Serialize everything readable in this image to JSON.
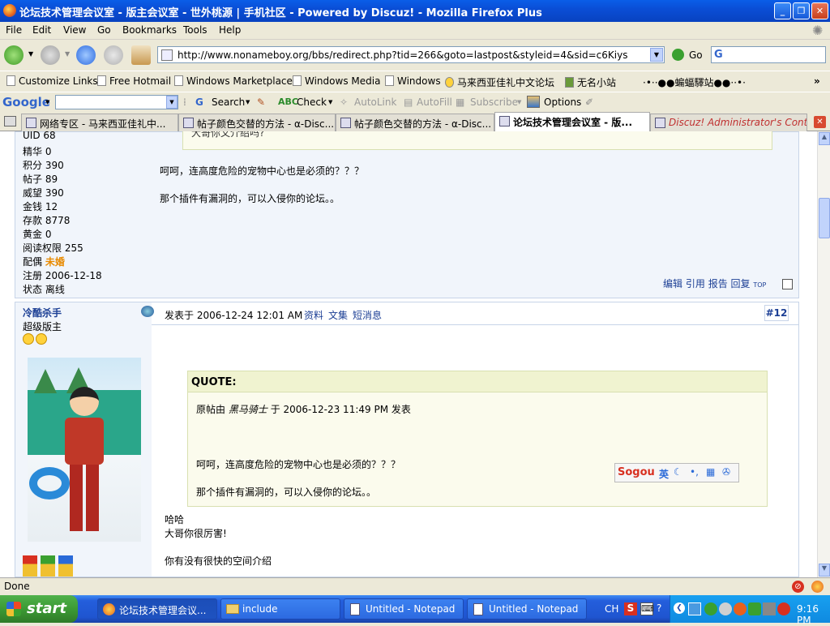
{
  "window": {
    "title": "论坛技术管理会议室 - 版主会议室 - 世外桃源 | 手机社区 - Powered by Discuz! - Mozilla Firefox Plus"
  },
  "menu": [
    "File",
    "Edit",
    "View",
    "Go",
    "Bookmarks",
    "Tools",
    "Help"
  ],
  "nav": {
    "url": "http://www.nonameboy.org/bbs/redirect.php?tid=266&goto=lastpost&styleid=4&sid=c6Kiys",
    "go_label": "Go"
  },
  "bookmarks": [
    "Customize Links",
    "Free Hotmail",
    "Windows Marketplace",
    "Windows Media",
    "Windows",
    "马来西亚佳礼中文论坛",
    "无名小站",
    "·•··●●蝙蝠驛站●●··•·"
  ],
  "googlebar": {
    "logo": "Google",
    "search": "Search",
    "check": "Check",
    "autolink": "AutoLink",
    "autofill": "AutoFill",
    "subscribe": "Subscribe",
    "options": "Options"
  },
  "tabs": [
    {
      "label": "网络专区 - 马来西亚佳礼中..."
    },
    {
      "label": "帖子颜色交替的方法 - α-Disc..."
    },
    {
      "label": "帖子颜色交替的方法 - α-Disc..."
    },
    {
      "label": "论坛技术管理会议室 - 版..."
    },
    {
      "label": "Discuz! Administrator's Cont..."
    }
  ],
  "post1": {
    "stats": [
      {
        "label": "UID",
        "value": "68"
      },
      {
        "label": "精华",
        "value": "0"
      },
      {
        "label": "积分",
        "value": "390"
      },
      {
        "label": "帖子",
        "value": "89"
      },
      {
        "label": "威望",
        "value": "390"
      },
      {
        "label": "金钱",
        "value": "12"
      },
      {
        "label": "存款",
        "value": "8778"
      },
      {
        "label": "黄金",
        "value": "0"
      },
      {
        "label": "阅读权限",
        "value": "255"
      },
      {
        "label": "配偶",
        "value": "未婚"
      },
      {
        "label": "注册",
        "value": "2006-12-18"
      },
      {
        "label": "状态",
        "value": "离线"
      }
    ],
    "quote_tail": "大哥你又介绍吗?",
    "line1": "呵呵，连高度危险的宠物中心也是必须的？？？",
    "line2": "那个插件有漏洞的，可以入侵你的论坛。。",
    "actions": [
      "编辑",
      "引用",
      "报告",
      "回复"
    ],
    "top_label": "TOP"
  },
  "post2": {
    "author": "冷酷杀手",
    "rank": "超级版主",
    "posted": "发表于 2006-12-24 12:01 AM",
    "links": [
      "资料",
      "文集",
      "短消息"
    ],
    "floor": "#12",
    "quote_title": "QUOTE:",
    "quote_meta_prefix": "原帖由",
    "quote_author": "黑马骑士",
    "quote_meta_suffix": "于 2006-12-23 11:49 PM 发表",
    "quote_line1": "呵呵，连高度危险的宠物中心也是必须的？？？",
    "quote_line2": "那个插件有漏洞的，可以入侵你的论坛。。",
    "reply1": "哈哈",
    "reply2": "大哥你很厉害!",
    "reply3": "你有没有很快的空间介绍"
  },
  "sogou": {
    "logo": "Sogou",
    "mode": "英"
  },
  "status": {
    "text": "Done"
  },
  "taskbar": {
    "start": "start",
    "tasks": [
      "论坛技术管理会议...",
      "include",
      "Untitled - Notepad",
      "Untitled - Notepad"
    ],
    "lang": "CH",
    "clock": "9:16 PM"
  },
  "colors": {
    "accent_blue": "#0a4ed6",
    "link_blue": "#1c3f95",
    "spouse_orange": "#e88a00"
  }
}
